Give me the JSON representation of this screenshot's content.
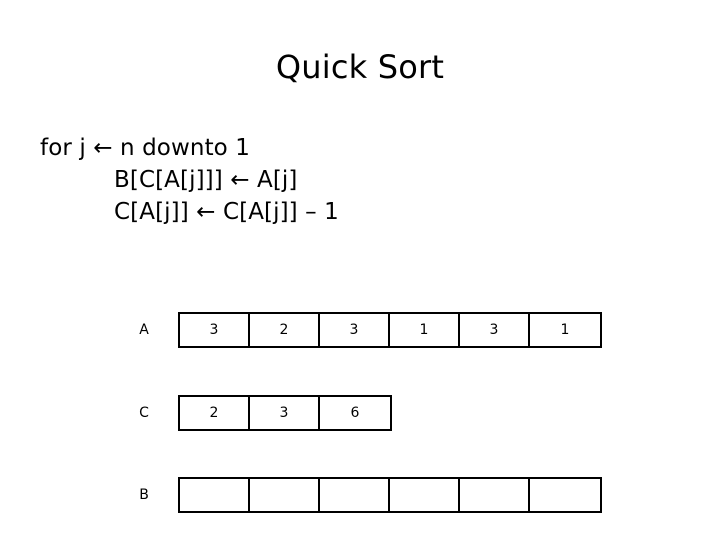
{
  "slide": {
    "title": "Quick Sort",
    "pseudocode": [
      {
        "indent": 0,
        "text": "for j ← n downto 1"
      },
      {
        "indent": 1,
        "text": "B[C[A[j]]] ← A[j]"
      },
      {
        "indent": 1,
        "text": "C[A[j]] ← C[A[j]] – 1"
      }
    ],
    "arrays": [
      {
        "label": "A",
        "cells": [
          "3",
          "2",
          "3",
          "1",
          "3",
          "1"
        ]
      },
      {
        "label": "C",
        "cells": [
          "2",
          "3",
          "6"
        ]
      },
      {
        "label": "B",
        "cells": [
          "",
          "",
          "",
          "",
          "",
          ""
        ]
      }
    ],
    "colors": {
      "background": "#ffffff",
      "text": "#000000",
      "border": "#000000"
    }
  }
}
